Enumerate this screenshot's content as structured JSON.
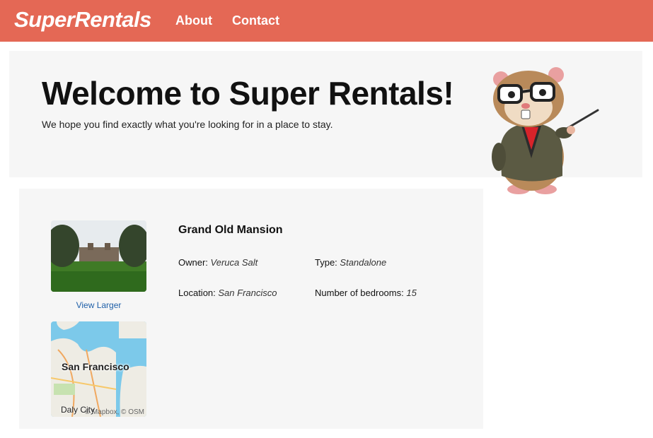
{
  "nav": {
    "brand": "SuperRentals",
    "links": [
      "About",
      "Contact"
    ]
  },
  "jumbo": {
    "title": "Welcome to Super Rentals!",
    "subtitle": "We hope you find exactly what you're looking for in a place to stay."
  },
  "rental": {
    "title": "Grand Old Mansion",
    "view_larger": "View Larger",
    "owner_label": "Owner:",
    "owner": "Veruca Salt",
    "type_label": "Type:",
    "type": "Standalone",
    "location_label": "Location:",
    "location": "San Francisco",
    "bedrooms_label": "Number of bedrooms:",
    "bedrooms": "15",
    "map": {
      "city_label": "San Francisco",
      "secondary_label": "Daly City",
      "attribution": "© Mapbox, © OSM"
    }
  },
  "colors": {
    "nav_bg": "#e46855",
    "panel_bg": "#f6f6f6",
    "link": "#1e5fa8"
  }
}
